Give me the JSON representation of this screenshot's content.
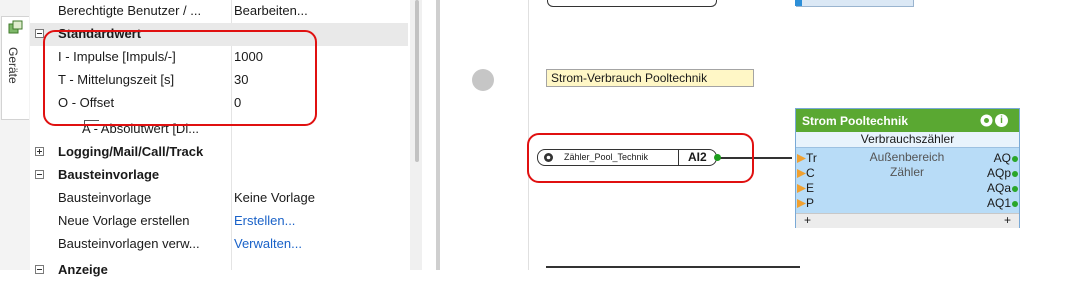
{
  "side_tab": {
    "label": "Geräte",
    "icon": "device-tree-icon"
  },
  "property_grid": {
    "rows": [
      {
        "name": "Berechtigte Benutzer / ...",
        "value": "Bearbeiten..."
      },
      {
        "category": "Standardwert"
      },
      {
        "name": "I - Impulse [Impuls/-]",
        "value": "1000"
      },
      {
        "name": "T - Mittelungszeit [s]",
        "value": "30"
      },
      {
        "name": "O - Offset",
        "value": "0"
      },
      {
        "name": "A - Absolutwert [Di...",
        "value": ""
      },
      {
        "category": "Logging/Mail/Call/Track"
      },
      {
        "category": "Bausteinvorlage"
      },
      {
        "name": "Bausteinvorlage",
        "value": "Keine Vorlage"
      },
      {
        "name": "Neue Vorlage erstellen",
        "value": "Erstellen..."
      },
      {
        "name": "Bausteinvorlagen verw...",
        "value": "Verwalten..."
      },
      {
        "category": "Anzeige"
      }
    ]
  },
  "canvas": {
    "comment": "Strom-Verbrauch Pooltechnik",
    "input_block": {
      "name": "Zähler_Pool_Technik",
      "address": "AI2"
    },
    "function_block": {
      "title": "Strom Pooltechnik",
      "type": "Verbrauchszähler",
      "subtitle1": "Außenbereich",
      "subtitle2": "Zähler",
      "inputs": [
        "Tr",
        "C",
        "E",
        "P",
        "+"
      ],
      "outputs": [
        "AQ",
        "AQp",
        "AQa",
        "AQ1",
        "+"
      ]
    }
  },
  "colors": {
    "block_header": "#5aa832",
    "block_body": "#b8dcf7",
    "comment_bg": "#fff7c6",
    "highlight": "#e01010",
    "link": "#1a62c8"
  }
}
